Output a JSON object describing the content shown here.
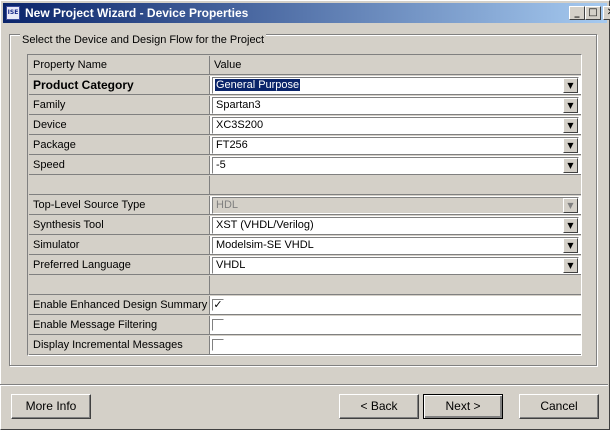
{
  "window": {
    "title": "New Project Wizard - Device Properties",
    "icon": "ise-app-icon"
  },
  "titlebar_buttons": {
    "minimize": "_",
    "maximize": "□",
    "close": "✕"
  },
  "group_label": "Select the Device and Design Flow for the Project",
  "grid": {
    "header": {
      "name": "Property Name",
      "value": "Value"
    },
    "rows": [
      {
        "name": "Product Category",
        "value": "General Purpose",
        "type": "combo",
        "bold": true,
        "selected": true
      },
      {
        "name": "Family",
        "value": "Spartan3",
        "type": "combo"
      },
      {
        "name": "Device",
        "value": "XC3S200",
        "type": "combo"
      },
      {
        "name": "Package",
        "value": "FT256",
        "type": "combo"
      },
      {
        "name": "Speed",
        "value": "-5",
        "type": "combo"
      },
      {
        "name": "",
        "value": "",
        "type": "empty"
      },
      {
        "name": "Top-Level Source Type",
        "value": "HDL",
        "type": "combo",
        "disabled": true
      },
      {
        "name": "Synthesis Tool",
        "value": "XST (VHDL/Verilog)",
        "type": "combo"
      },
      {
        "name": "Simulator",
        "value": "Modelsim-SE VHDL",
        "type": "combo"
      },
      {
        "name": "Preferred Language",
        "value": "VHDL",
        "type": "combo"
      },
      {
        "name": "",
        "value": "",
        "type": "empty"
      },
      {
        "name": "Enable Enhanced Design Summary",
        "checked": true,
        "type": "checkbox"
      },
      {
        "name": "Enable Message Filtering",
        "checked": false,
        "type": "checkbox"
      },
      {
        "name": "Display Incremental Messages",
        "checked": false,
        "type": "checkbox"
      }
    ]
  },
  "buttons": {
    "more_info": "More Info",
    "back": "< Back",
    "next": "Next >",
    "cancel": "Cancel"
  },
  "glyphs": {
    "dropdown_arrow": "▼",
    "check": "✓"
  }
}
